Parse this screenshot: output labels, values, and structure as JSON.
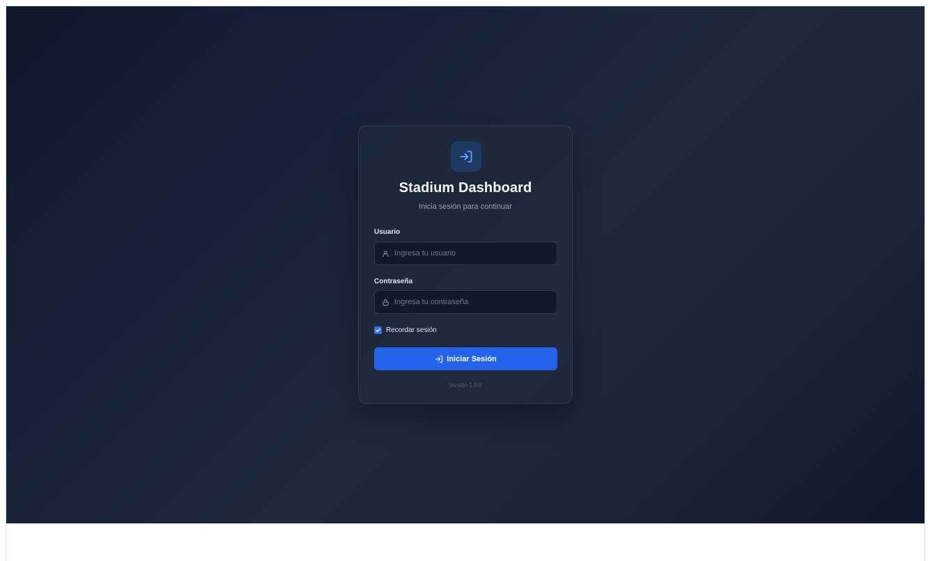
{
  "app": {
    "title": "Stadium Dashboard",
    "subtitle": "Inicia sesión para continuar",
    "logo_icon": "login-arrow-icon"
  },
  "form": {
    "username": {
      "label": "Usuario",
      "placeholder": "Ingresa tu usuario",
      "value": "",
      "icon": "user-icon"
    },
    "password": {
      "label": "Contraseña",
      "placeholder": "Ingresa tu contraseña",
      "value": "",
      "icon": "lock-icon"
    },
    "remember": {
      "label": "Recordar sesión",
      "checked": true
    },
    "submit_label": "Iniciar Sesión",
    "submit_icon": "login-arrow-icon"
  },
  "footer": {
    "version": "Versión 1.0.0"
  },
  "colors": {
    "accent": "#2563eb",
    "background": "#0f172a",
    "card": "#1e293b",
    "icon_accent": "#60a5fa"
  }
}
